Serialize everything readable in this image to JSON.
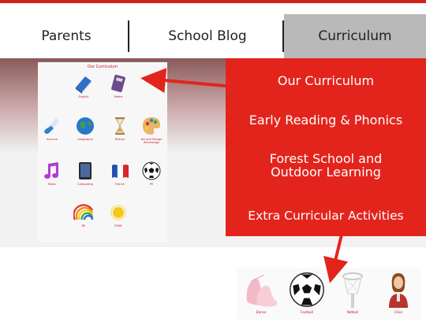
{
  "nav": {
    "items": [
      {
        "label": "Parents"
      },
      {
        "label": "School Blog"
      },
      {
        "label": "Curriculum",
        "active": true
      }
    ]
  },
  "dropdown": {
    "items": [
      "Our Curriculum",
      "Early Reading & Phonics",
      "Forest School and Outdoor Learning",
      "Extra Curricular Activities"
    ]
  },
  "curriculum_thumbnail": {
    "title": "Our Curriculum",
    "subjects": [
      {
        "label": "English",
        "icon": "blue-book-icon"
      },
      {
        "label": "Maths",
        "icon": "calculator-icon"
      },
      {
        "label": "Science",
        "icon": "test-tube-icon"
      },
      {
        "label": "Geography",
        "icon": "globe-icon"
      },
      {
        "label": "History",
        "icon": "hourglass-icon"
      },
      {
        "label": "Art and Design Technology",
        "icon": "paint-palette-icon"
      },
      {
        "label": "Music",
        "icon": "music-note-icon"
      },
      {
        "label": "Computing",
        "icon": "tablet-icon"
      },
      {
        "label": "French",
        "icon": "french-flag-icon"
      },
      {
        "label": "PE",
        "icon": "football-icon"
      },
      {
        "label": "RE",
        "icon": "rainbow-icon"
      },
      {
        "label": "PSHE",
        "icon": "sun-icon"
      }
    ]
  },
  "clubs": {
    "items": [
      {
        "label": "Dance",
        "icon": "ballet-shoes-icon"
      },
      {
        "label": "Football",
        "icon": "football-icon"
      },
      {
        "label": "Netball",
        "icon": "netball-hoop-icon"
      },
      {
        "label": "Choir",
        "icon": "singer-icon"
      }
    ]
  },
  "colors": {
    "accent_red": "#e3241c",
    "nav_active_bg": "#b9b9b9",
    "label_red": "#c8102e"
  }
}
